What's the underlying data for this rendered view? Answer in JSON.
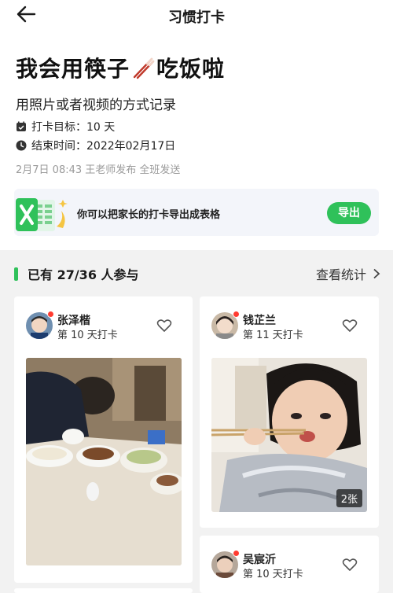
{
  "header": {
    "title": "习惯打卡"
  },
  "task": {
    "headline_before": "我会用筷子",
    "headline_after": "吃饭啦",
    "subtitle": "用照片或者视频的方式记录",
    "goal_label": "打卡目标：10 天",
    "end_label": "结束时间：2022年02月17日",
    "posted": "2月7日 08:43  王老师发布  全班发送"
  },
  "banner": {
    "text": "你可以把家长的打卡导出成表格",
    "export_label": "导出"
  },
  "participants": {
    "summary": "已有 27/36 人参与",
    "stats_label": "查看统计"
  },
  "entries": [
    {
      "name": "张泽楷",
      "days": "第 10 天打卡"
    },
    {
      "name": "钱芷兰",
      "days": "第 11 天打卡",
      "photo_count": "2张"
    },
    {
      "name": "吴宸沂",
      "days": "第 10 天打卡"
    }
  ],
  "colors": {
    "accent": "#2fc15a",
    "badge_red": "#ff3b30",
    "panel_bg": "#f2f2f2"
  }
}
